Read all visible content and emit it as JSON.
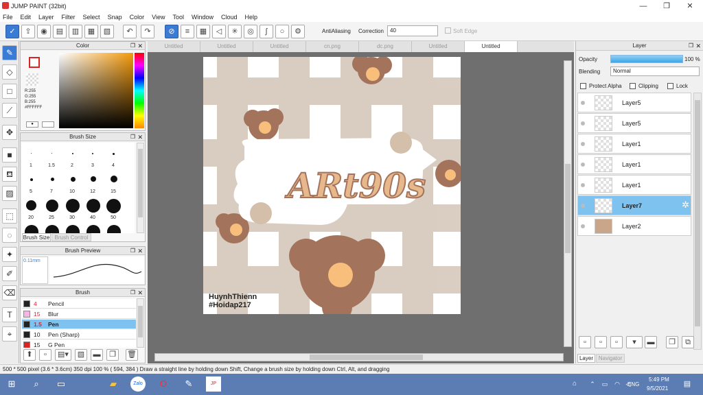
{
  "window": {
    "title": "JUMP PAINT (32bit)",
    "minimize": "—",
    "maximize": "❐",
    "close": "✕"
  },
  "menu": [
    "File",
    "Edit",
    "Layer",
    "Filter",
    "Select",
    "Snap",
    "Color",
    "View",
    "Tool",
    "Window",
    "Cloud",
    "Help"
  ],
  "toolbar": {
    "antialiasing_label": "AntiAliasing",
    "correction_label": "Correction",
    "correction_value": "40",
    "softedge_label": "Soft Edge"
  },
  "color_panel": {
    "title": "Color",
    "r": "R:255",
    "g": "G:255",
    "b": "B:255",
    "hex": "#FFFFFF"
  },
  "brush_size_panel": {
    "title": "Brush Size",
    "sizes": [
      "1",
      "1.5",
      "2",
      "3",
      "4",
      "5",
      "7",
      "10",
      "12",
      "15",
      "20",
      "25",
      "30",
      "40",
      "50"
    ],
    "tab_active": "Brush Size",
    "tab_inactive": "Brush Control"
  },
  "brush_preview_panel": {
    "title": "Brush Preview",
    "size": "0.11mm"
  },
  "brush_panel": {
    "title": "Brush",
    "items": [
      {
        "size": "4",
        "name": "Pencil",
        "color": "#222222"
      },
      {
        "size": "15",
        "name": "Blur",
        "color": "#f4b6e0"
      },
      {
        "size": "1.5",
        "name": "Pen",
        "color": "#222222"
      },
      {
        "size": "10",
        "name": "Pen (Sharp)",
        "color": "#222222"
      },
      {
        "size": "15",
        "name": "G Pen",
        "color": "#d22222"
      }
    ]
  },
  "tabs": [
    "Untitled",
    "Untitled",
    "Untitled",
    "cn.png",
    "dc.png",
    "Untitled",
    "Untitled"
  ],
  "canvas": {
    "title_art": "ARt90s",
    "credit_line1": "HuynhThienn",
    "credit_line2": "#Hoidap217"
  },
  "layer_panel": {
    "title": "Layer",
    "opacity_label": "Opacity",
    "opacity_value": "100 %",
    "opacity_level": 1.0,
    "blending_label": "Blending",
    "blending_value": "Normal",
    "protect_alpha": "Protect Alpha",
    "clipping": "Clipping",
    "lock": "Lock",
    "layers": [
      "Layer5",
      "Layer5",
      "Layer1",
      "Layer1",
      "Layer1",
      "Layer7",
      "Layer2"
    ],
    "tab_active": "Layer",
    "tab_inactive": "Navigator"
  },
  "status": "500 * 500 pixel  (3.6 * 3.6cm)  350 dpi  100 %  ( 594, 384 )  Draw a straight line by holding down Shift, Change a brush size by holding down Ctrl, Alt, and dragging",
  "taskbar": {
    "lang": "ENG",
    "time": "5:49 PM",
    "date": "9/5/2021"
  }
}
